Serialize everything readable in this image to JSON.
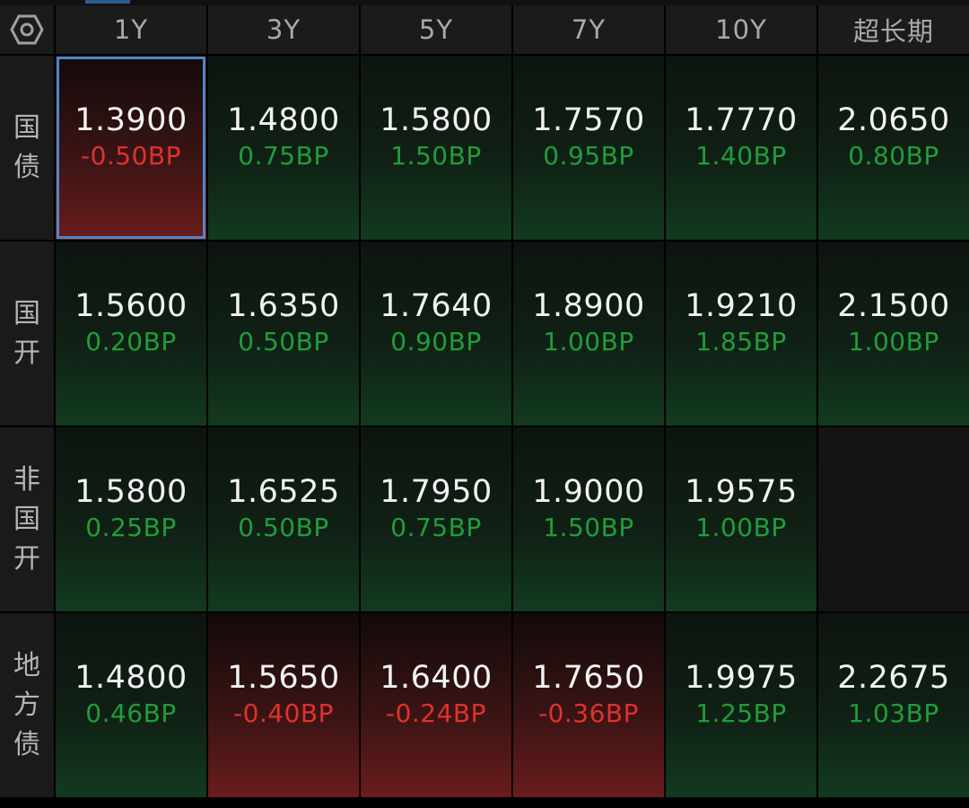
{
  "header": {
    "settings_icon": "hexagon-settings-icon",
    "columns": [
      "1Y",
      "3Y",
      "5Y",
      "7Y",
      "10Y",
      "超长期"
    ]
  },
  "rows": [
    {
      "label": "国\n债",
      "cells": [
        {
          "value": "1.3900",
          "change": "-0.50BP",
          "direction": "down",
          "selected": true
        },
        {
          "value": "1.4800",
          "change": "0.75BP",
          "direction": "up"
        },
        {
          "value": "1.5800",
          "change": "1.50BP",
          "direction": "up"
        },
        {
          "value": "1.7570",
          "change": "0.95BP",
          "direction": "up"
        },
        {
          "value": "1.7770",
          "change": "1.40BP",
          "direction": "up"
        },
        {
          "value": "2.0650",
          "change": "0.80BP",
          "direction": "up"
        }
      ]
    },
    {
      "label": "国\n开",
      "cells": [
        {
          "value": "1.5600",
          "change": "0.20BP",
          "direction": "up"
        },
        {
          "value": "1.6350",
          "change": "0.50BP",
          "direction": "up"
        },
        {
          "value": "1.7640",
          "change": "0.90BP",
          "direction": "up"
        },
        {
          "value": "1.8900",
          "change": "1.00BP",
          "direction": "up"
        },
        {
          "value": "1.9210",
          "change": "1.85BP",
          "direction": "up"
        },
        {
          "value": "2.1500",
          "change": "1.00BP",
          "direction": "up"
        }
      ]
    },
    {
      "label": "非\n国\n开",
      "cells": [
        {
          "value": "1.5800",
          "change": "0.25BP",
          "direction": "up"
        },
        {
          "value": "1.6525",
          "change": "0.50BP",
          "direction": "up"
        },
        {
          "value": "1.7950",
          "change": "0.75BP",
          "direction": "up"
        },
        {
          "value": "1.9000",
          "change": "1.50BP",
          "direction": "up"
        },
        {
          "value": "1.9575",
          "change": "1.00BP",
          "direction": "up"
        },
        {
          "value": "",
          "change": "",
          "direction": "empty"
        }
      ]
    },
    {
      "label": "地\n方\n债",
      "cells": [
        {
          "value": "1.4800",
          "change": "0.46BP",
          "direction": "up"
        },
        {
          "value": "1.5650",
          "change": "-0.40BP",
          "direction": "down"
        },
        {
          "value": "1.6400",
          "change": "-0.24BP",
          "direction": "down"
        },
        {
          "value": "1.7650",
          "change": "-0.36BP",
          "direction": "down"
        },
        {
          "value": "1.9975",
          "change": "1.25BP",
          "direction": "up"
        },
        {
          "value": "2.2675",
          "change": "1.03BP",
          "direction": "up"
        }
      ]
    }
  ],
  "colors": {
    "positive": "#1f9e3a",
    "negative": "#e0312e",
    "selected_border": "#4f86c6"
  }
}
